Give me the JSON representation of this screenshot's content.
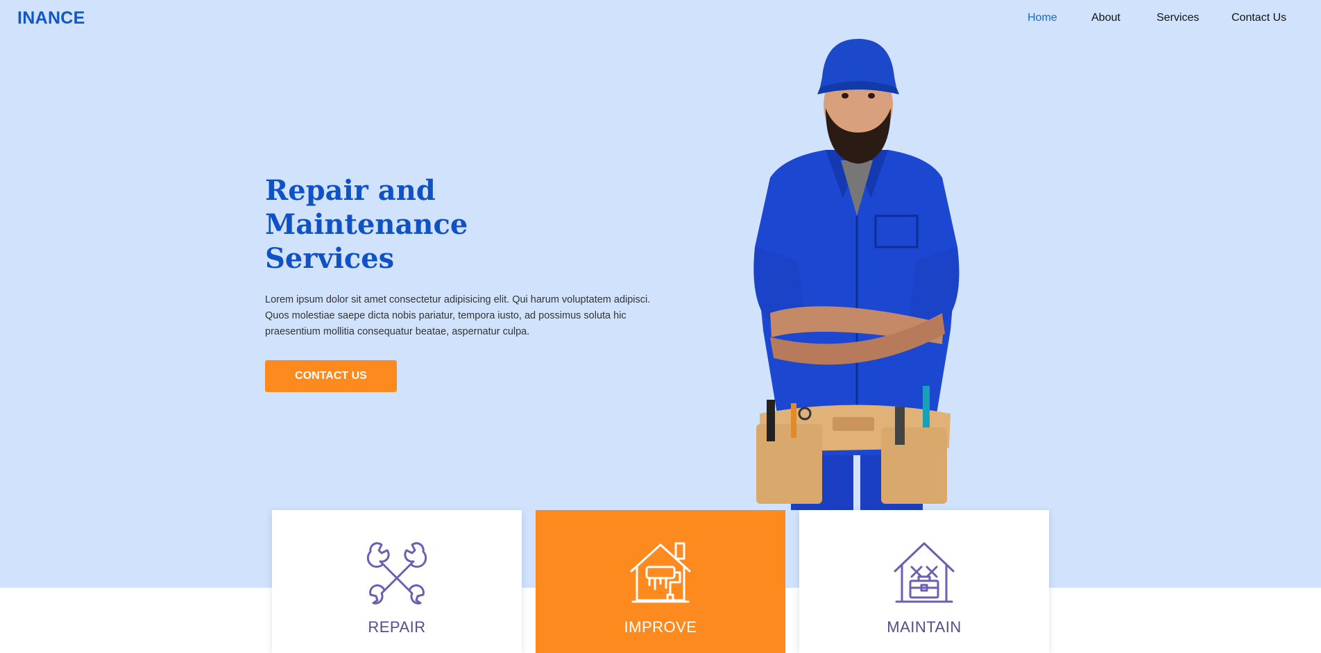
{
  "header": {
    "logo": "INANCE",
    "nav": [
      {
        "label": "Home",
        "active": true
      },
      {
        "label": "About",
        "active": false
      },
      {
        "label": "Services",
        "active": false
      },
      {
        "label": "Contact Us",
        "active": false
      }
    ]
  },
  "hero": {
    "title_lines": [
      "Repair and",
      "Maintenance",
      "Services"
    ],
    "description": "Lorem ipsum dolor sit amet consectetur adipisicing elit. Qui harum voluptatem adipisci. Quos molestiae saepe dicta nobis pariatur, tempora iusto, ad possimus soluta hic praesentium mollitia consequatur beatae, aspernatur culpa.",
    "cta_label": "CONTACT US",
    "image_icon": "handyman-photo"
  },
  "services": [
    {
      "label": "REPAIR",
      "icon": "crossed-wrenches-icon"
    },
    {
      "label": "IMPROVE",
      "icon": "house-paint-roller-icon"
    },
    {
      "label": "MAINTAIN",
      "icon": "house-toolbox-icon"
    }
  ],
  "colors": {
    "hero_bg": "#d1e3fc",
    "brand_blue": "#0f52c5",
    "accent_orange": "#fd8a1f",
    "icon_purple": "#6a5fb0"
  }
}
